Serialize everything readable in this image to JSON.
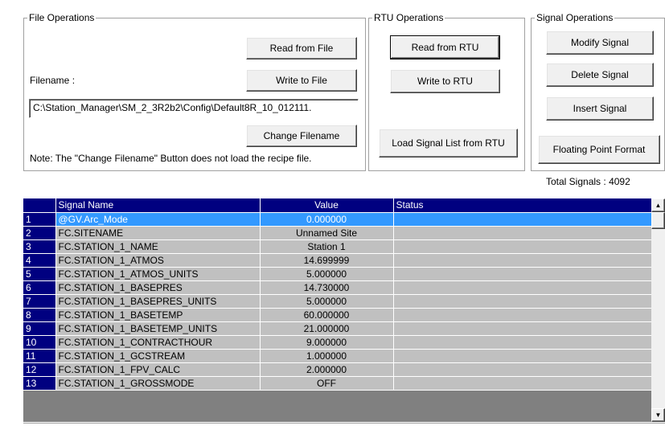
{
  "file_ops": {
    "legend": "File Operations",
    "read_label": "Read from File",
    "write_label": "Write to File",
    "filename_label": "Filename :",
    "filename_value": "C:\\Station_Manager\\SM_2_3R2b2\\Config\\Default8R_10_012111.",
    "change_label": "Change Filename",
    "note": "Note: The \"Change Filename\" Button does not load the recipe file."
  },
  "rtu_ops": {
    "legend": "RTU Operations",
    "read_label": "Read from RTU",
    "write_label": "Write to RTU",
    "load_label": "Load Signal List from RTU"
  },
  "signal_ops": {
    "legend": "Signal Operations",
    "modify_label": "Modify Signal",
    "delete_label": "Delete Signal",
    "insert_label": "Insert Signal",
    "float_label": "Floating Point Format"
  },
  "total": {
    "label": "Total Signals :",
    "count": "4092"
  },
  "grid": {
    "columns": [
      "Signal Name",
      "Value",
      "Status"
    ],
    "rows": [
      {
        "n": "1",
        "name": "@GV.Arc_Mode",
        "value": "0.000000",
        "status": ""
      },
      {
        "n": "2",
        "name": "FC.SITENAME",
        "value": "Unnamed Site",
        "status": ""
      },
      {
        "n": "3",
        "name": "FC.STATION_1_NAME",
        "value": "Station 1",
        "status": ""
      },
      {
        "n": "4",
        "name": "FC.STATION_1_ATMOS",
        "value": "14.699999",
        "status": ""
      },
      {
        "n": "5",
        "name": "FC.STATION_1_ATMOS_UNITS",
        "value": "5.000000",
        "status": ""
      },
      {
        "n": "6",
        "name": "FC.STATION_1_BASEPRES",
        "value": "14.730000",
        "status": ""
      },
      {
        "n": "7",
        "name": "FC.STATION_1_BASEPRES_UNITS",
        "value": "5.000000",
        "status": ""
      },
      {
        "n": "8",
        "name": "FC.STATION_1_BASETEMP",
        "value": "60.000000",
        "status": ""
      },
      {
        "n": "9",
        "name": "FC.STATION_1_BASETEMP_UNITS",
        "value": "21.000000",
        "status": ""
      },
      {
        "n": "10",
        "name": "FC.STATION_1_CONTRACTHOUR",
        "value": "9.000000",
        "status": ""
      },
      {
        "n": "11",
        "name": "FC.STATION_1_GCSTREAM",
        "value": "1.000000",
        "status": ""
      },
      {
        "n": "12",
        "name": "FC.STATION_1_FPV_CALC",
        "value": "2.000000",
        "status": ""
      },
      {
        "n": "13",
        "name": "FC.STATION_1_GROSSMODE",
        "value": "OFF",
        "status": ""
      }
    ],
    "selected_row": 1
  },
  "icons": {
    "scroll_up": "up-arrow-icon",
    "scroll_down": "down-arrow-icon"
  },
  "colors": {
    "header_bg": "#000080",
    "selected_bg": "#3399ff",
    "cell_bg": "#c0c0c0"
  }
}
